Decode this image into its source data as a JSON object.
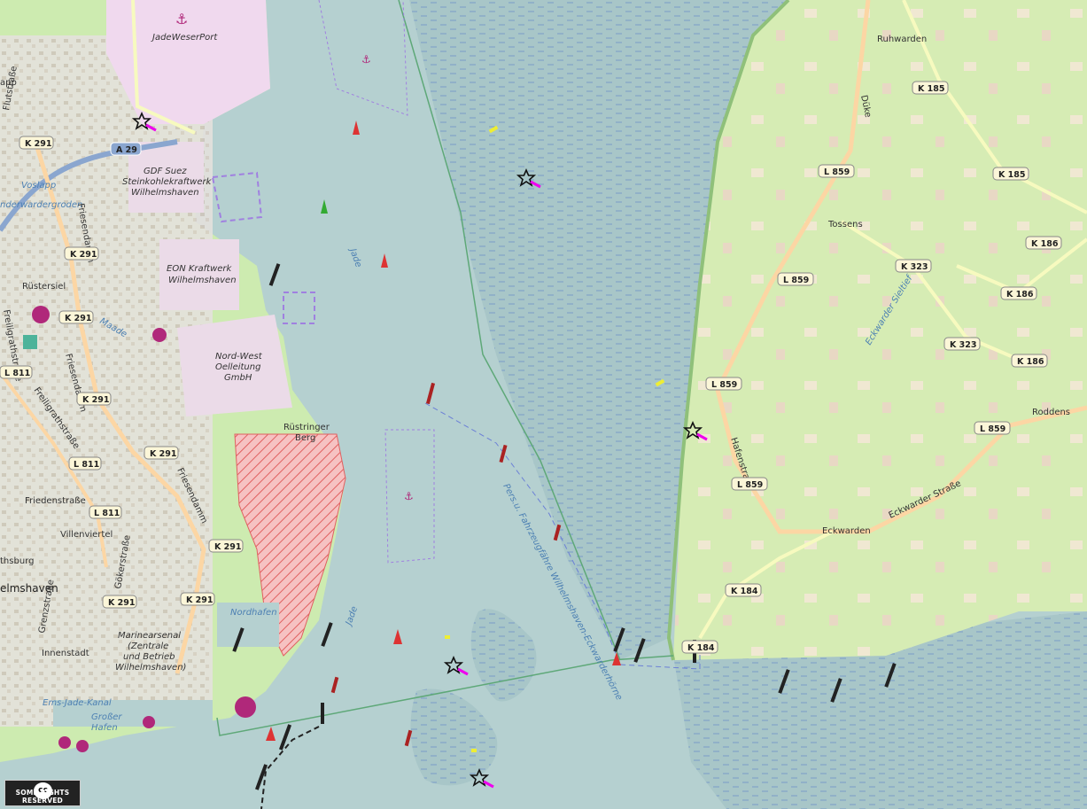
{
  "map": {
    "colors": {
      "water": "#b5d0d0",
      "tidal_flat": "#a4c1c4",
      "grass": "#cdebb0",
      "farmland": "#eef0d5",
      "port": "#f0d9ee",
      "residential": "#e0dfdf",
      "industrial": "#ebdbe8",
      "military_hatch": "#f2a6a6",
      "road_secondary": "#f7fabf",
      "road_tertiary": "#fcd6a4",
      "motorway": "#8aa6cf",
      "marker_magenta": "#b0287a"
    },
    "places": {
      "jadeweserport": "JadeWeserPort",
      "ruhwarden": "Ruhwarden",
      "tossens": "Tossens",
      "eckwarden": "Eckwarden",
      "rustersiel": "Rüstersiel",
      "rustringer_berg": "Rüstringer\nBerg",
      "villenviertel": "Villenviertel",
      "innenstadt": "Innenstadt",
      "wilhelmshaven": "elmshaven",
      "nordhafen": "Nordhafen",
      "grosser_hafen_1": "Großer",
      "grosser_hafen_2": "Hafen",
      "voslapp": "Voslapp",
      "app": "app",
      "thsburg": "thsburg"
    },
    "facilities": {
      "gdf_1": "GDF Suez",
      "gdf_2": "Steinkohlekraftwerk",
      "gdf_3": "Wilhelmshaven",
      "eon_1": "EON Kraftwerk",
      "eon_2": "Wilhelmshaven",
      "nwo_1": "Nord-West",
      "nwo_2": "Oelleitung",
      "nwo_3": "GmbH",
      "marine_1": "Marinearsenal",
      "marine_2": "(Zentrale",
      "marine_3": "und Betrieb",
      "marine_4": "Wilhelmshaven)"
    },
    "water_labels": {
      "jade_1": "Jade",
      "jade_2": "Jade",
      "maade": "Maade",
      "ems_jade_kanal": "Ems-Jade-Kanal",
      "eckwarder_sieltief": "Eckwarder Sieltief",
      "fahrwasser": "Pers.u. Fahrzeugfähre Wilhelmshaven-Eckwarderhörne",
      "voslapp_water": "nderwardergroden"
    },
    "streets": {
      "flutstrasse": "Flutstraße",
      "friesendamm_1": "Friesendamm",
      "friesendamm_2": "Friesendamm",
      "friesendamm_3": "Friesendamm",
      "freiligrathstrasse_1": "Freiligrathstraße",
      "freiligrathstrasse_2": "Freiligrathstraße",
      "friedenstrasse": "Friedenstraße",
      "gokerstrasse": "Gökerstraße",
      "grenzstrasse": "Grenzstraße",
      "duke": "Düke",
      "hafenstrasse": "Hafenstraße",
      "eckwarder_strasse": "Eckwarder Straße",
      "roddens": "Roddens"
    },
    "road_refs": {
      "a29": "A 29",
      "k291_a": "K 291",
      "k291_b": "K 291",
      "k291_c": "K 291",
      "k291_d": "K 291",
      "k291_e": "K 291",
      "k291_f": "K 291",
      "k291_g": "K 291",
      "k291_h": "K 291",
      "l811_a": "L 811",
      "l811_b": "L 811",
      "l811_c": "L 811",
      "k185_a": "K 185",
      "k185_b": "K 185",
      "l859_a": "L 859",
      "l859_b": "L 859",
      "l859_c": "L 859",
      "l859_d": "L 859",
      "l859_e": "L 859",
      "k186_a": "K 186",
      "k186_b": "K 186",
      "k186_c": "K 186",
      "k323_a": "K 323",
      "k323_b": "K 323",
      "k184_a": "K 184",
      "k184_b": "K 184"
    },
    "icons": {
      "anchor": "anchor-icon",
      "lighthouse": "lighthouse-icon",
      "star_beacon": "star-beacon-icon",
      "buoy": "buoy-icon"
    }
  },
  "attribution": {
    "cc_logo": "cc",
    "text": "SOME RIGHTS RESERVED"
  }
}
